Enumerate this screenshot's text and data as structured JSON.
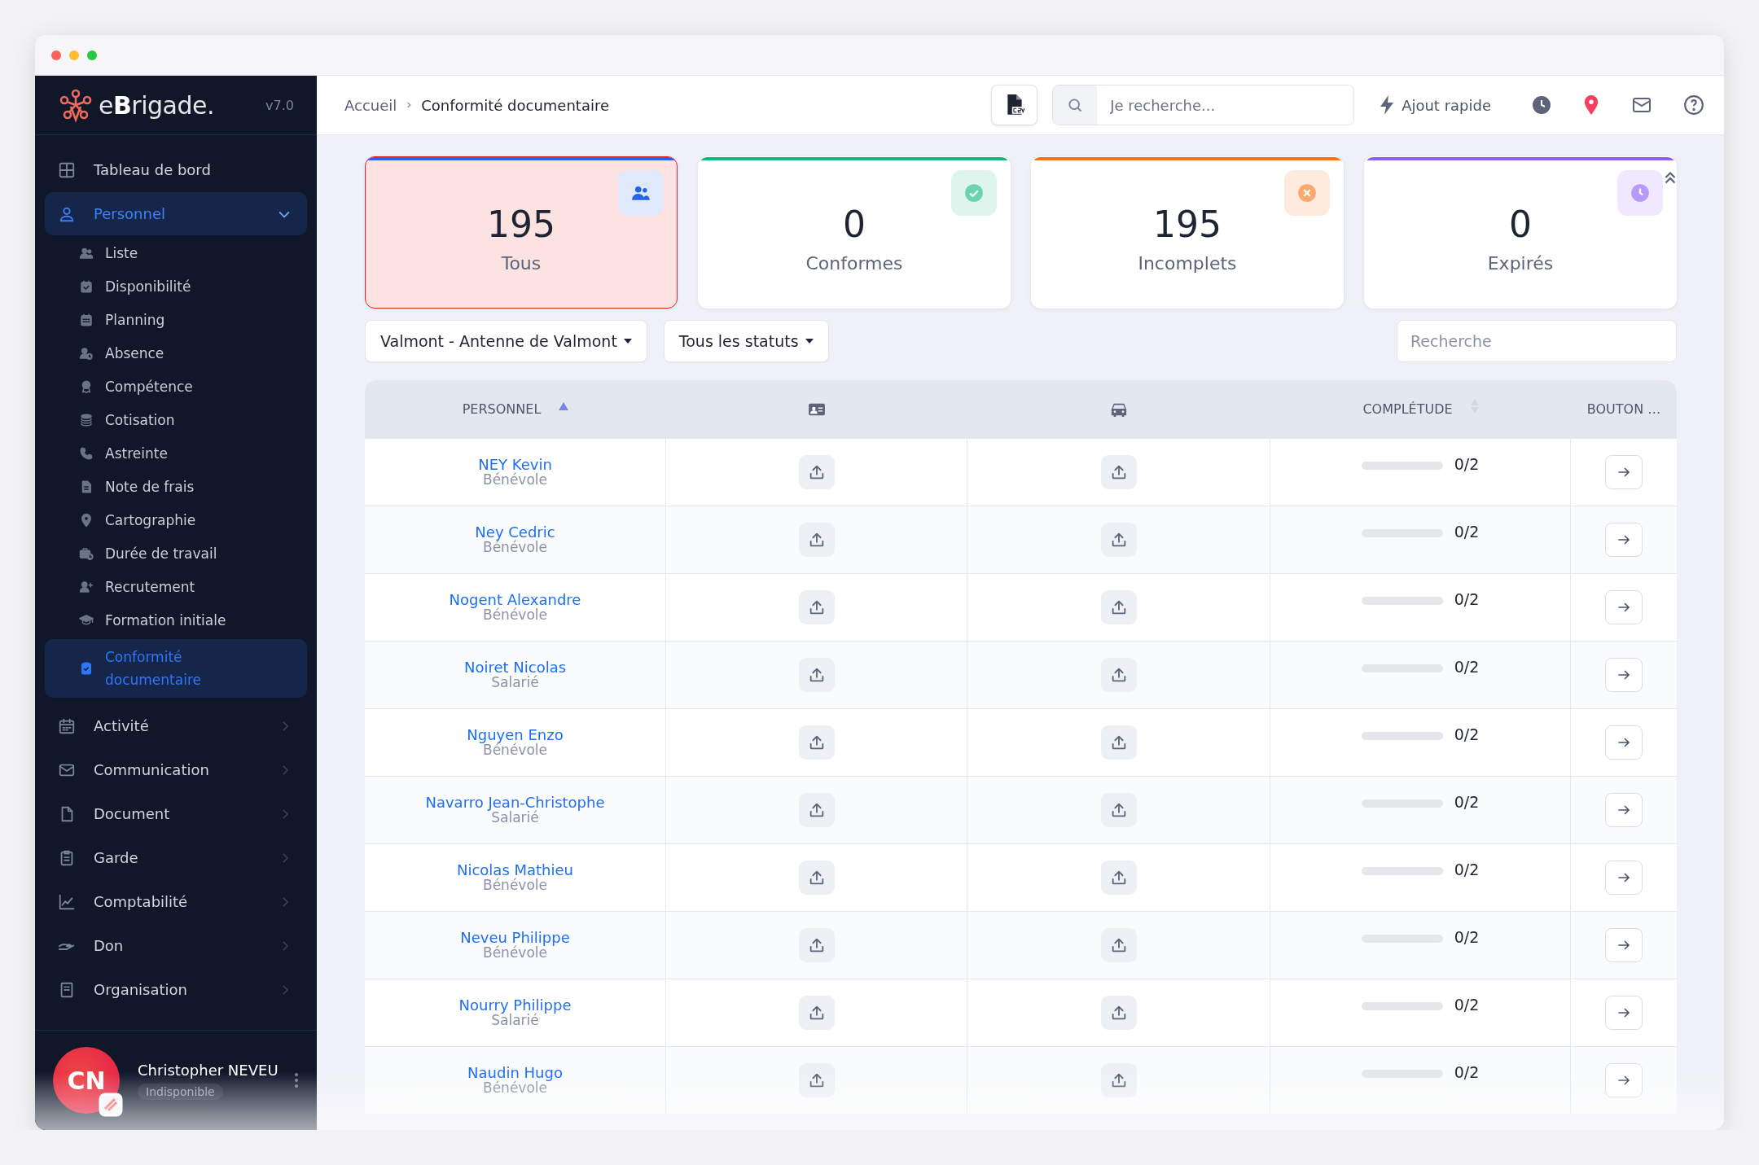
{
  "sidebar": {
    "logo": "e**B**rigade.",
    "version": "v7.0",
    "items": [
      {
        "label": "Tableau de bord",
        "selected": false
      },
      {
        "label": "Personnel",
        "selected": true,
        "expanded": true,
        "children": [
          {
            "label": "Liste",
            "selected": false
          },
          {
            "label": "Disponibilité",
            "selected": false
          },
          {
            "label": "Planning",
            "selected": false
          },
          {
            "label": "Absence",
            "selected": false
          },
          {
            "label": "Compétence",
            "selected": false
          },
          {
            "label": "Cotisation",
            "selected": false
          },
          {
            "label": "Astreinte",
            "selected": false
          },
          {
            "label": "Note de frais",
            "selected": false
          },
          {
            "label": "Cartographie",
            "selected": false
          },
          {
            "label": "Durée de travail",
            "selected": false
          },
          {
            "label": "Recrutement",
            "selected": false
          },
          {
            "label": "Formation initiale",
            "selected": false
          },
          {
            "label": "Conformité documentaire",
            "selected": true
          }
        ]
      },
      {
        "label": "Activité",
        "selected": false,
        "expanded": false
      },
      {
        "label": "Communication",
        "selected": false,
        "expanded": false
      },
      {
        "label": "Document",
        "selected": false,
        "expanded": false
      },
      {
        "label": "Garde",
        "selected": false,
        "expanded": false
      },
      {
        "label": "Comptabilité",
        "selected": false,
        "expanded": false
      },
      {
        "label": "Don",
        "selected": false,
        "expanded": false
      },
      {
        "label": "Organisation",
        "selected": false,
        "expanded": false
      }
    ],
    "user": {
      "initials": "CN",
      "name": "Christopher NEVEU",
      "status": "Indisponible"
    }
  },
  "topbar": {
    "breadcrumb": [
      "Accueil",
      "Conformité documentaire"
    ],
    "search": {
      "placeholder": "Je recherche..."
    },
    "quick_add": "Ajout rapide"
  },
  "cards": [
    {
      "count": "195",
      "label": "Tous",
      "color": "#2563eb",
      "selected": true
    },
    {
      "count": "0",
      "label": "Conformes",
      "color": "#10b981",
      "selected": false
    },
    {
      "count": "195",
      "label": "Incomplets",
      "color": "#f97316",
      "selected": false
    },
    {
      "count": "0",
      "label": "Expirés",
      "color": "#8b5cf6",
      "selected": false
    }
  ],
  "filters": {
    "dropdowns": [
      "Valmont - Antenne de Valmont",
      "Tous les statuts"
    ],
    "search": {
      "placeholder": "Recherche"
    }
  },
  "table": {
    "columns": [
      {
        "kind": "text",
        "label": "PERSONNEL",
        "sorted": true
      },
      {
        "kind": "icon"
      },
      {
        "kind": "icon"
      },
      {
        "kind": "text",
        "label": "COMPLÉTUDE",
        "sorted": false
      },
      {
        "kind": "text",
        "label": "BOUTON …"
      }
    ],
    "rows": [
      {
        "name": "NEY Kevin",
        "role": "Bénévole",
        "level": 0,
        "progress": "0/2"
      },
      {
        "name": "Ney Cedric",
        "role": "Bénévole",
        "level": 0,
        "progress": "0/2"
      },
      {
        "name": "Nogent Alexandre",
        "role": "Bénévole",
        "level": 0,
        "progress": "0/2"
      },
      {
        "name": "Noiret Nicolas",
        "role": "Salarié",
        "level": 0,
        "progress": "0/2"
      },
      {
        "name": "Nguyen Enzo",
        "role": "Bénévole",
        "level": 0,
        "progress": "0/2"
      },
      {
        "name": "Navarro Jean-Christophe",
        "role": "Salarié",
        "level": 0,
        "progress": "0/2"
      },
      {
        "name": "Nicolas Mathieu",
        "role": "Bénévole",
        "level": 0,
        "progress": "0/2"
      },
      {
        "name": "Neveu Philippe",
        "role": "Bénévole",
        "level": 0,
        "progress": "0/2"
      },
      {
        "name": "Nourry Philippe",
        "role": "Salarié",
        "level": 0,
        "progress": "0/2"
      },
      {
        "name": "Naudin Hugo",
        "role": "Bénévole",
        "level": 0,
        "progress": "0/2"
      }
    ]
  }
}
